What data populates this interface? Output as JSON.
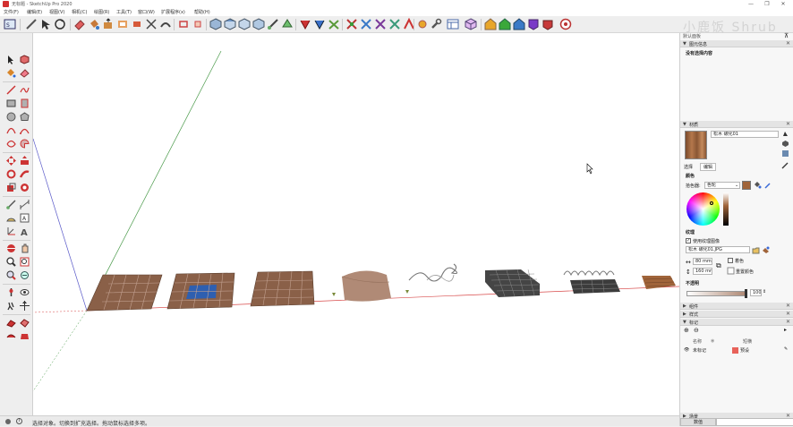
{
  "window": {
    "title": "无标题 - SketchUp Pro 2020",
    "controls": [
      "—",
      "❐",
      "✕"
    ]
  },
  "menu": [
    "文件(F)",
    "编辑(E)",
    "视图(V)",
    "相机(C)",
    "绘图(R)",
    "工具(T)",
    "窗口(W)",
    "扩展程序(x)",
    "帮助(H)"
  ],
  "watermark": "小鹿饭 Shrub",
  "status": {
    "text": "选择对象。切换到扩充选择。拖动鼠标选择多项。"
  },
  "tray": {
    "default_tray": "默认面板",
    "entity_info": {
      "title": "图元信息",
      "text": "没有选择内容"
    },
    "materials": {
      "title": "材质",
      "material_name": "松木 碳化01",
      "tabs": [
        "选择",
        "编辑"
      ],
      "color_heading": "颜色",
      "picker_label": "拾色器:",
      "picker_value": "色轮",
      "texture_heading": "纹理",
      "use_texture_label": "使用纹理图像",
      "texture_file": "松木 碳化01.JPG",
      "width_value": "80 mm",
      "height_value": "160 mm",
      "colorize_label": "着色",
      "reset_label": "重置颜色",
      "opacity_heading": "不透明",
      "opacity_value": "100",
      "accent_color": "#a0643a"
    },
    "collapsed_panels": [
      "组件",
      "样式",
      "标记"
    ],
    "tags": {
      "columns": [
        "名称",
        "",
        "短横"
      ],
      "rows": [
        {
          "name": "未标记",
          "dash": "预设",
          "swatch": "#e8625a"
        }
      ]
    },
    "bottom_panel": "场景",
    "bottom_button": "数值"
  },
  "colors": {
    "red_axis": "#d84a4a",
    "green_axis": "#4a9a4a",
    "blue_axis": "#5a5ac8",
    "tile_brown": "#8a6048",
    "tile_blue": "#2e5fb0",
    "terrain": "#b08a76",
    "dark_block": "#454545"
  }
}
